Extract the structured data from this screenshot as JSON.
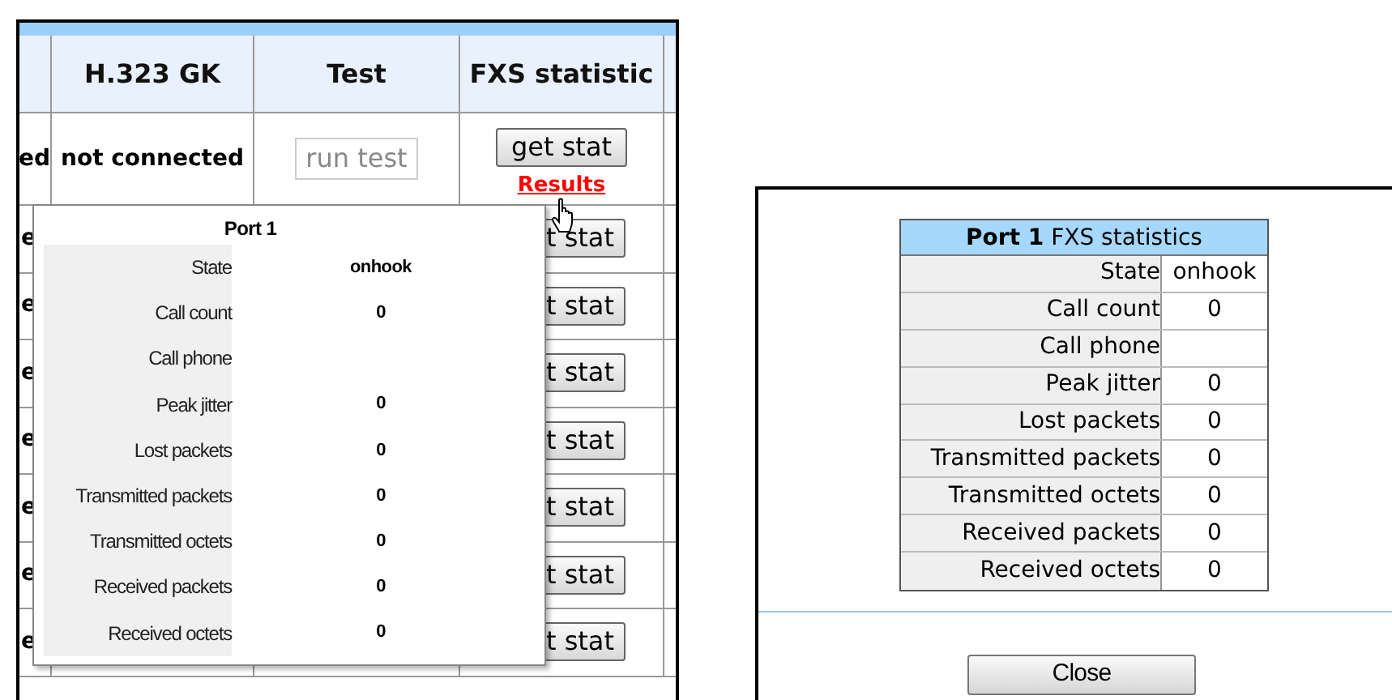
{
  "port_table": {
    "columns": [
      {
        "label": "H.323 GK"
      },
      {
        "label": "Test"
      },
      {
        "label": "FXS statistic"
      }
    ],
    "first_row": {
      "column_1": "ed",
      "gk_status": "not connected",
      "test_button": {
        "label": "run test",
        "disabled": true
      },
      "stat_button": "get stat",
      "results_link": "Results"
    },
    "covered_rows": [
      {
        "column_1": "e",
        "stat_button": "t stat"
      },
      {
        "column_1": "e",
        "stat_button": "t stat"
      },
      {
        "column_1": "e",
        "stat_button": "t stat"
      },
      {
        "column_1": "e",
        "stat_button": "t stat"
      },
      {
        "column_1": "e",
        "stat_button": "t stat"
      },
      {
        "column_1": "e",
        "stat_button": "t stat"
      },
      {
        "column_1": "e",
        "stat_button": "t stat"
      }
    ]
  },
  "popup": {
    "title": "Port 1",
    "rows": [
      {
        "label": "State",
        "value": "onhook"
      },
      {
        "label": "Call count",
        "value": "0"
      },
      {
        "label": "Call phone"
      },
      {
        "label": "Peak jitter",
        "value": "0"
      },
      {
        "label": "Lost packets",
        "value": "0"
      },
      {
        "label": "Transmitted packets",
        "value": "0"
      },
      {
        "label": "Transmitted octets",
        "value": "0"
      },
      {
        "label": "Received packets",
        "value": "0"
      },
      {
        "label": "Received octets",
        "value": "0"
      }
    ]
  },
  "stats_dialog": {
    "title": "**Port 1** FXS statistics",
    "rows": [
      {
        "label": "State",
        "value": "onhook"
      },
      {
        "label": "Call count",
        "value": "0"
      },
      {
        "label": "Call phone"
      },
      {
        "label": "Peak jitter",
        "value": "0"
      },
      {
        "label": "Lost packets",
        "value": "0"
      },
      {
        "label": "Transmitted packets",
        "value": "0"
      },
      {
        "label": "Transmitted octets",
        "value": "0"
      },
      {
        "label": "Received packets",
        "value": "0"
      },
      {
        "label": "Received octets",
        "value": "0"
      }
    ],
    "close_button": "Close"
  }
}
